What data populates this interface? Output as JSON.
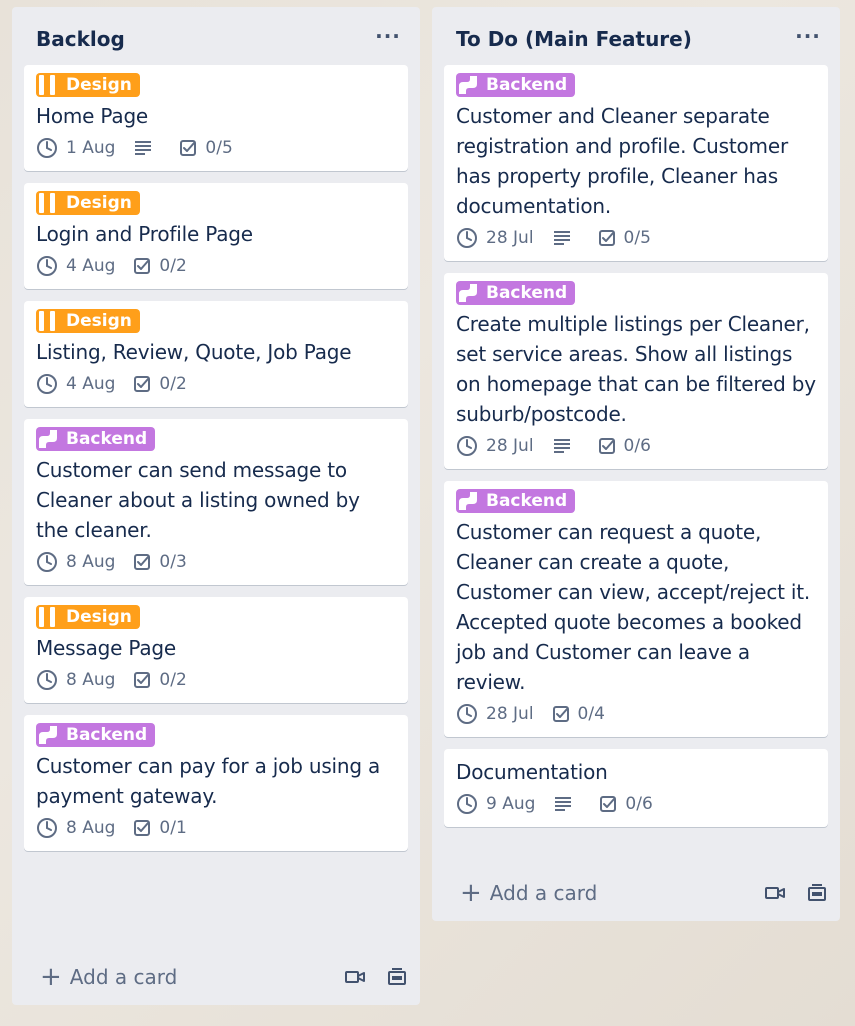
{
  "colors": {
    "list_bg": "#ebecf0",
    "design": "#ff9f1a",
    "backend": "#c377e0",
    "meta": "#5e6c84",
    "text": "#172b4d"
  },
  "lists": [
    {
      "title": "Backlog",
      "more_icon": "ellipsis-icon",
      "add_card": "Add a card",
      "cards": [
        {
          "label": "Design",
          "title": "Home Page",
          "due": "1 Aug",
          "has_description": true,
          "checklist": "0/5"
        },
        {
          "label": "Design",
          "title": "Login and Profile Page",
          "due": "4 Aug",
          "has_description": false,
          "checklist": "0/2"
        },
        {
          "label": "Design",
          "title": "Listing, Review, Quote, Job Page",
          "due": "4 Aug",
          "has_description": false,
          "checklist": "0/2"
        },
        {
          "label": "Backend",
          "title": "Customer can send message to Cleaner about a listing owned by the cleaner.",
          "due": "8 Aug",
          "has_description": false,
          "checklist": "0/3"
        },
        {
          "label": "Design",
          "title": "Message Page",
          "due": "8 Aug",
          "has_description": false,
          "checklist": "0/2"
        },
        {
          "label": "Backend",
          "title": "Customer can pay for a job using a payment gateway.",
          "due": "8 Aug",
          "has_description": false,
          "checklist": "0/1"
        }
      ]
    },
    {
      "title": "To Do (Main Feature)",
      "more_icon": "ellipsis-icon",
      "add_card": "Add a card",
      "cards": [
        {
          "label": "Backend",
          "title": "Customer and Cleaner separate registration and profile. Customer has property profile, Cleaner has documentation.",
          "due": "28 Jul",
          "has_description": true,
          "checklist": "0/5"
        },
        {
          "label": "Backend",
          "title": "Create multiple listings per Cleaner, set service areas. Show all listings on homepage that can be filtered by suburb/postcode.",
          "due": "28 Jul",
          "has_description": true,
          "checklist": "0/6"
        },
        {
          "label": "Backend",
          "title": "Customer can request a quote, Cleaner can create a quote, Customer can view, accept/reject it. Accepted quote becomes a booked job and Customer can leave a review.",
          "due": "28 Jul",
          "has_description": false,
          "checklist": "0/4"
        },
        {
          "label": "",
          "title": "Documentation",
          "due": "9 Aug",
          "has_description": true,
          "checklist": "0/6"
        }
      ]
    }
  ]
}
